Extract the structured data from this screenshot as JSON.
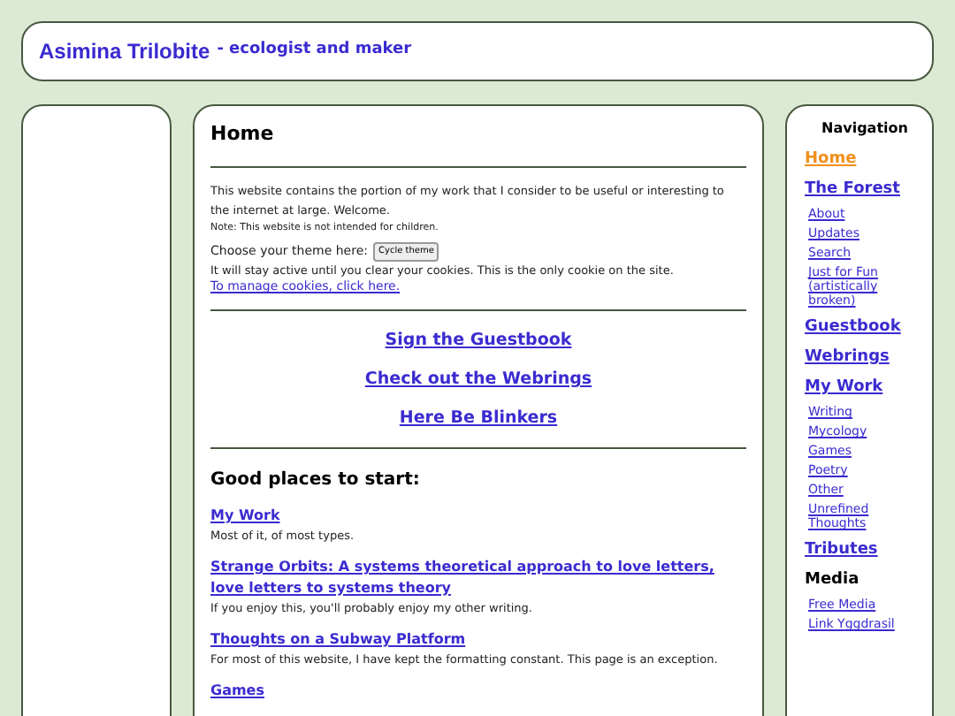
{
  "header": {
    "title": "Asimina Trilobite",
    "subtitle": "- ecologist and maker"
  },
  "main": {
    "heading": "Home",
    "intro": "This website contains the portion of my work that I consider to be useful or interesting to the internet at large. Welcome.",
    "note": "Note: This website is not intended for children.",
    "theme_label": "Choose your theme here:",
    "theme_button": "Cycle theme",
    "cookie_text": "It will stay active until you clear your cookies. This is the only cookie on the site.",
    "cookie_link": "To manage cookies, click here.",
    "big_links": [
      "Sign the Guestbook",
      "Check out the Webrings",
      "Here Be Blinkers"
    ],
    "start_heading": "Good places to start:",
    "start_items": [
      {
        "title": "My Work",
        "desc": "Most of it, of most types."
      },
      {
        "title": "Strange Orbits: A systems theoretical approach to love letters, love letters to systems theory",
        "desc": "If you enjoy this, you'll probably enjoy my other writing."
      },
      {
        "title": "Thoughts on a Subway Platform",
        "desc": "For most of this website, I have kept the formatting constant. This page is an exception."
      },
      {
        "title": "Games"
      }
    ]
  },
  "navigation": {
    "title": "Navigation",
    "items": [
      {
        "kind": "section",
        "label": "Home",
        "selected": true
      },
      {
        "kind": "section",
        "label": "The Forest",
        "selected": false
      },
      {
        "kind": "sub",
        "label": "About",
        "selected": false
      },
      {
        "kind": "sub",
        "label": "Updates",
        "selected": false
      },
      {
        "kind": "sub",
        "label": "Search",
        "selected": false
      },
      {
        "kind": "sub",
        "label": "Just for Fun (artistically broken)",
        "selected": false
      },
      {
        "kind": "section",
        "label": "Guestbook",
        "selected": false
      },
      {
        "kind": "section",
        "label": "Webrings",
        "selected": false
      },
      {
        "kind": "section",
        "label": "My Work",
        "selected": false
      },
      {
        "kind": "sub",
        "label": "Writing",
        "selected": false
      },
      {
        "kind": "sub",
        "label": "Mycology",
        "selected": false
      },
      {
        "kind": "sub",
        "label": "Games",
        "selected": false
      },
      {
        "kind": "sub",
        "label": "Poetry",
        "selected": false
      },
      {
        "kind": "sub",
        "label": "Other",
        "selected": false
      },
      {
        "kind": "sub",
        "label": "Unrefined Thoughts",
        "selected": false
      },
      {
        "kind": "section",
        "label": "Tributes",
        "selected": false
      },
      {
        "kind": "heading",
        "label": "Media"
      },
      {
        "kind": "sub",
        "label": "Free Media",
        "selected": false
      },
      {
        "kind": "sub",
        "label": "Link Yggdrasil",
        "selected": false
      }
    ]
  }
}
